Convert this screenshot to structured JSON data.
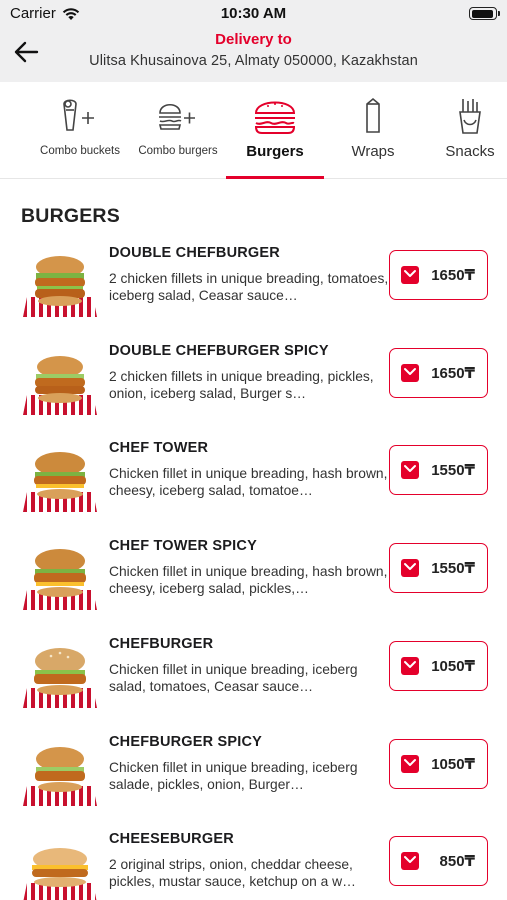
{
  "status_bar": {
    "carrier": "Carrier",
    "time": "10:30 AM"
  },
  "header": {
    "delivery_label": "Delivery to",
    "address": "Ulitsa Khusainova 25, Almaty 050000, Kazakhstan"
  },
  "tabs": [
    {
      "label": "Combo buckets",
      "icon": "bucket-plus-icon"
    },
    {
      "label": "Combo burgers",
      "icon": "burger-plus-icon"
    },
    {
      "label": "Burgers",
      "icon": "burger-icon",
      "active": true
    },
    {
      "label": "Wraps",
      "icon": "wrap-icon"
    },
    {
      "label": "Snacks",
      "icon": "fries-icon"
    }
  ],
  "section_title": "BURGERS",
  "products": [
    {
      "name": "DOUBLE CHEFBURGER",
      "description": "2 chicken fillets in unique breading, tomatoes, iceberg salad, Ceasar sauce…",
      "price": "1650₸"
    },
    {
      "name": "DOUBLE CHEFBURGER SPICY",
      "description": "2 chicken fillets in unique breading, pickles, onion, iceberg salad,  Burger s…",
      "price": "1650₸"
    },
    {
      "name": "CHEF TOWER",
      "description": "Chicken fillet in unique breading, hash brown, cheesy, iceberg salad, tomatoe…",
      "price": "1550₸"
    },
    {
      "name": "CHEF TOWER SPICY",
      "description": "Chicken fillet in unique breading, hash brown, cheesy, iceberg salad, pickles,…",
      "price": "1550₸"
    },
    {
      "name": "CHEFBURGER",
      "description": "Chicken fillet in unique breading, iceberg salad, tomatoes, Ceasar sauce…",
      "price": "1050₸"
    },
    {
      "name": "CHEFBURGER SPICY",
      "description": "Chicken fillet in unique breading, iceberg salade, pickles, onion, Burger…",
      "price": "1050₸"
    },
    {
      "name": "CHEESEBURGER",
      "description": "2 original strips, onion, cheddar cheese, pickles, mustar sauce, ketchup  on a w…",
      "price": "850₸"
    }
  ],
  "colors": {
    "accent": "#e4002b",
    "header_bg": "#efeff0"
  }
}
